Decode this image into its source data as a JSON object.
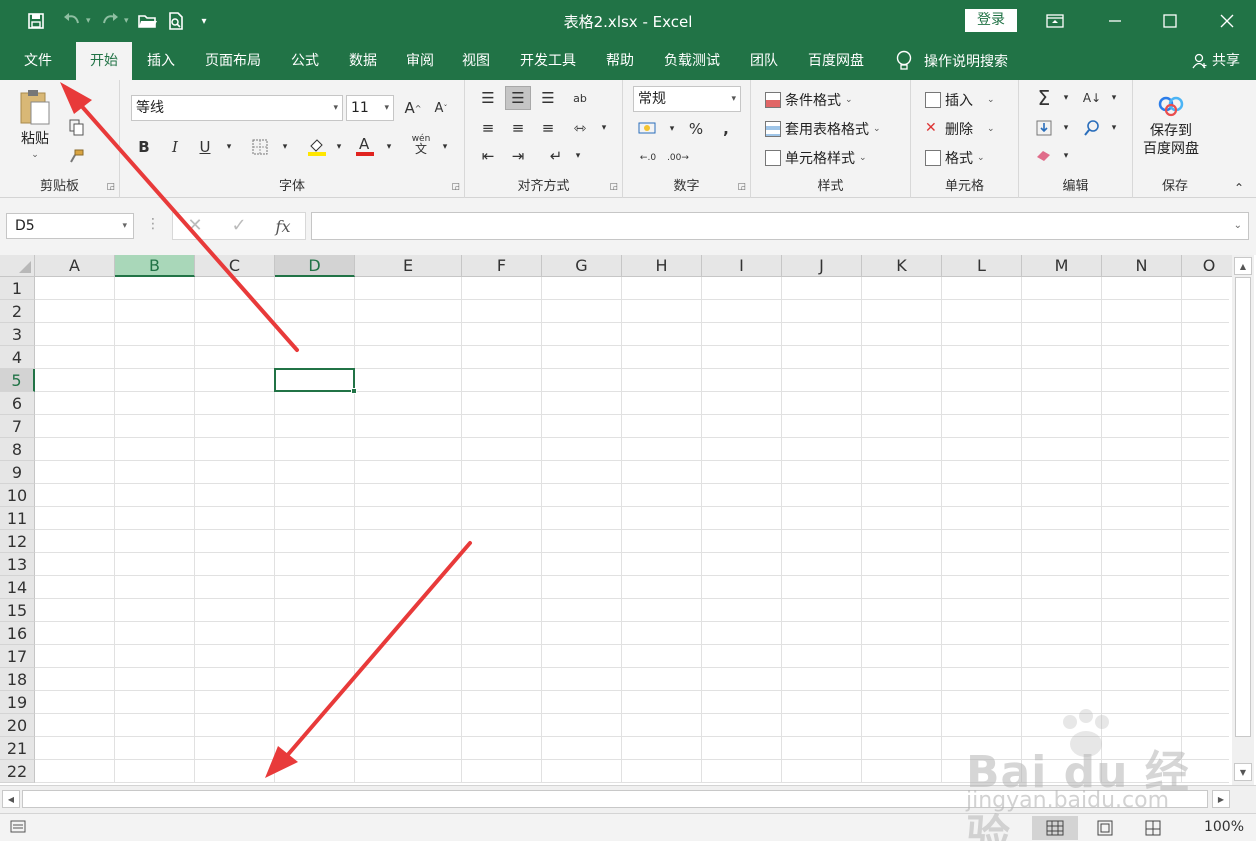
{
  "window": {
    "title": "表格2.xlsx  -  Excel",
    "login_label": "登录",
    "share_label": "共享",
    "help_search_label": "操作说明搜索"
  },
  "quick_access": [
    "save-icon",
    "undo-icon",
    "redo-icon",
    "open-folder-icon",
    "print-preview-icon",
    "customize-icon"
  ],
  "tabs": [
    {
      "label": "文件"
    },
    {
      "label": "开始"
    },
    {
      "label": "插入"
    },
    {
      "label": "页面布局"
    },
    {
      "label": "公式"
    },
    {
      "label": "数据"
    },
    {
      "label": "审阅"
    },
    {
      "label": "视图"
    },
    {
      "label": "开发工具"
    },
    {
      "label": "帮助"
    },
    {
      "label": "负载测试"
    },
    {
      "label": "团队"
    },
    {
      "label": "百度网盘"
    }
  ],
  "active_tab": "开始",
  "ribbon": {
    "clipboard": {
      "label": "剪贴板",
      "paste": "粘贴"
    },
    "font": {
      "label": "字体",
      "font_name": "等线",
      "font_size": "11",
      "font_color": "#e0231f",
      "fill_color": "#ffe600",
      "wen": "wén",
      "wen_char": "文"
    },
    "alignment": {
      "label": "对齐方式"
    },
    "number": {
      "label": "数字",
      "format": "常规",
      "percent": "%",
      "comma": ",",
      "inc": ".0\n.00",
      "dec": ".00\n.0"
    },
    "styles": {
      "label": "样式",
      "conditional": "条件格式",
      "table": "套用表格格式",
      "cell_styles": "单元格样式"
    },
    "cells": {
      "label": "单元格",
      "insert": "插入",
      "delete": "删除",
      "format": "格式"
    },
    "editing": {
      "label": "编辑"
    },
    "save": {
      "label": "保存",
      "button": "保存到\n百度网盘"
    }
  },
  "formula_bar": {
    "name_box": "D5",
    "fx": "fx",
    "content": ""
  },
  "grid": {
    "columns": [
      "A",
      "B",
      "C",
      "D",
      "E",
      "F",
      "G",
      "H",
      "I",
      "J",
      "K",
      "L",
      "M",
      "N",
      "O"
    ],
    "rows": [
      "1",
      "2",
      "3",
      "4",
      "5",
      "6",
      "7",
      "8",
      "9",
      "10",
      "11",
      "12",
      "13",
      "14",
      "15",
      "16",
      "17",
      "18",
      "19",
      "20",
      "21",
      "22"
    ],
    "selected_cell": "D5",
    "highlighted_column": "B"
  },
  "status": {
    "zoom": "100%"
  },
  "watermark": {
    "main": "Bai du 经验",
    "sub": "jingyan.baidu.com"
  },
  "colors": {
    "excel_green": "#217346",
    "arrow_red": "#e83a3a"
  }
}
